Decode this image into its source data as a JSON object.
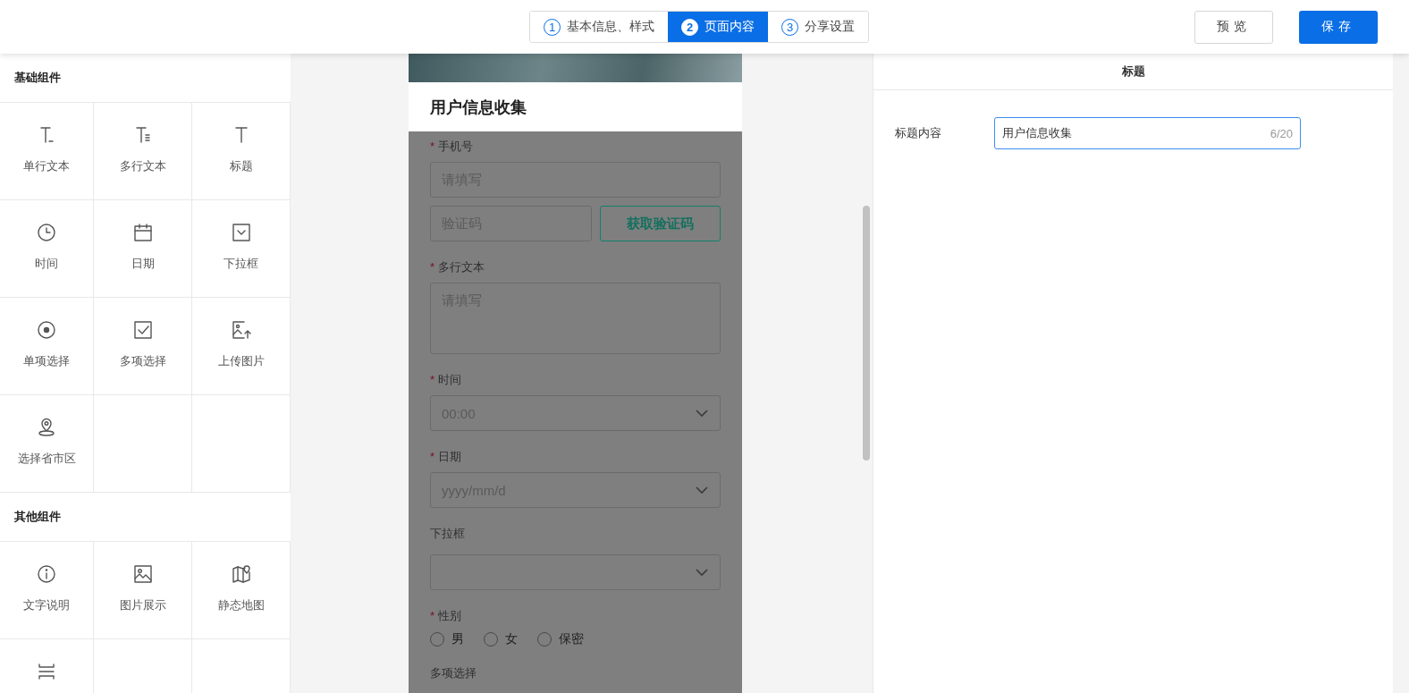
{
  "steps": [
    {
      "number": "1",
      "label": "基本信息、样式",
      "selected": false
    },
    {
      "number": "2",
      "label": "页面内容",
      "selected": true
    },
    {
      "number": "3",
      "label": "分享设置",
      "selected": false
    }
  ],
  "actions": [
    {
      "kind": "outline",
      "label": "预览"
    },
    {
      "kind": "primary",
      "label": "保存"
    }
  ],
  "palette": [
    {
      "title": "基础组件",
      "items": [
        "单行文本",
        "多行文本",
        "标题",
        "时间",
        "日期",
        "下拉框",
        "单项选择",
        "多项选择",
        "上传图片",
        "选择省市区"
      ]
    },
    {
      "title": "其他组件",
      "items": [
        "文字说明",
        "图片展示",
        "静态地图"
      ]
    }
  ],
  "preview": {
    "title": "用户信息收集",
    "fields": [
      {
        "kind": "phone",
        "label": "手机号",
        "marker": "*",
        "placeholder": "请填写",
        "code_placeholder": "验证码",
        "code_button": "获取验证码"
      },
      {
        "kind": "textarea",
        "label": "多行文本",
        "marker": "*",
        "placeholder": "请填写"
      },
      {
        "kind": "select",
        "label": "时间",
        "marker": "*",
        "placeholder": "00:00"
      },
      {
        "kind": "select",
        "label": "日期",
        "marker": "*",
        "placeholder": "yyyy/mm/d"
      },
      {
        "kind": "select",
        "label": "下拉框"
      },
      {
        "kind": "radio",
        "label": "性别",
        "marker": "*",
        "options": [
          {
            "label": "男",
            "selected": false
          },
          {
            "label": "女",
            "selected": false
          },
          {
            "label": "保密",
            "selected": false
          }
        ]
      },
      {
        "kind": "checkbox",
        "label": "多项选择"
      }
    ]
  },
  "properties": {
    "heading": "标题",
    "label": "标题内容",
    "value": "用户信息收集",
    "counter": "6/20"
  }
}
